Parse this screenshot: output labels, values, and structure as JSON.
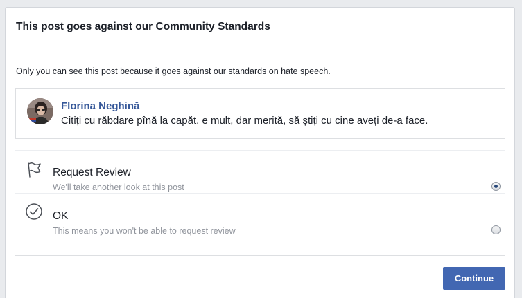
{
  "dialog": {
    "title": "This post goes against our Community Standards",
    "notice": "Only you can see this post because it goes against our standards on hate speech."
  },
  "post": {
    "author": "Florina Neghină",
    "text": "Citiți cu răbdare pînă la capăt. e mult, dar merită, să știți cu cine aveți de-a face."
  },
  "options": [
    {
      "title": "Request Review",
      "subtitle": "We'll take another look at this post",
      "icon": "flag-icon",
      "selected": true
    },
    {
      "title": "OK",
      "subtitle": "This means you won't be able to request review",
      "icon": "check-circle-icon",
      "selected": false
    }
  ],
  "footer": {
    "continue_label": "Continue"
  },
  "colors": {
    "primary_button": "#4267b2",
    "author_link": "#365899",
    "subtitle_gray": "#90949c"
  }
}
